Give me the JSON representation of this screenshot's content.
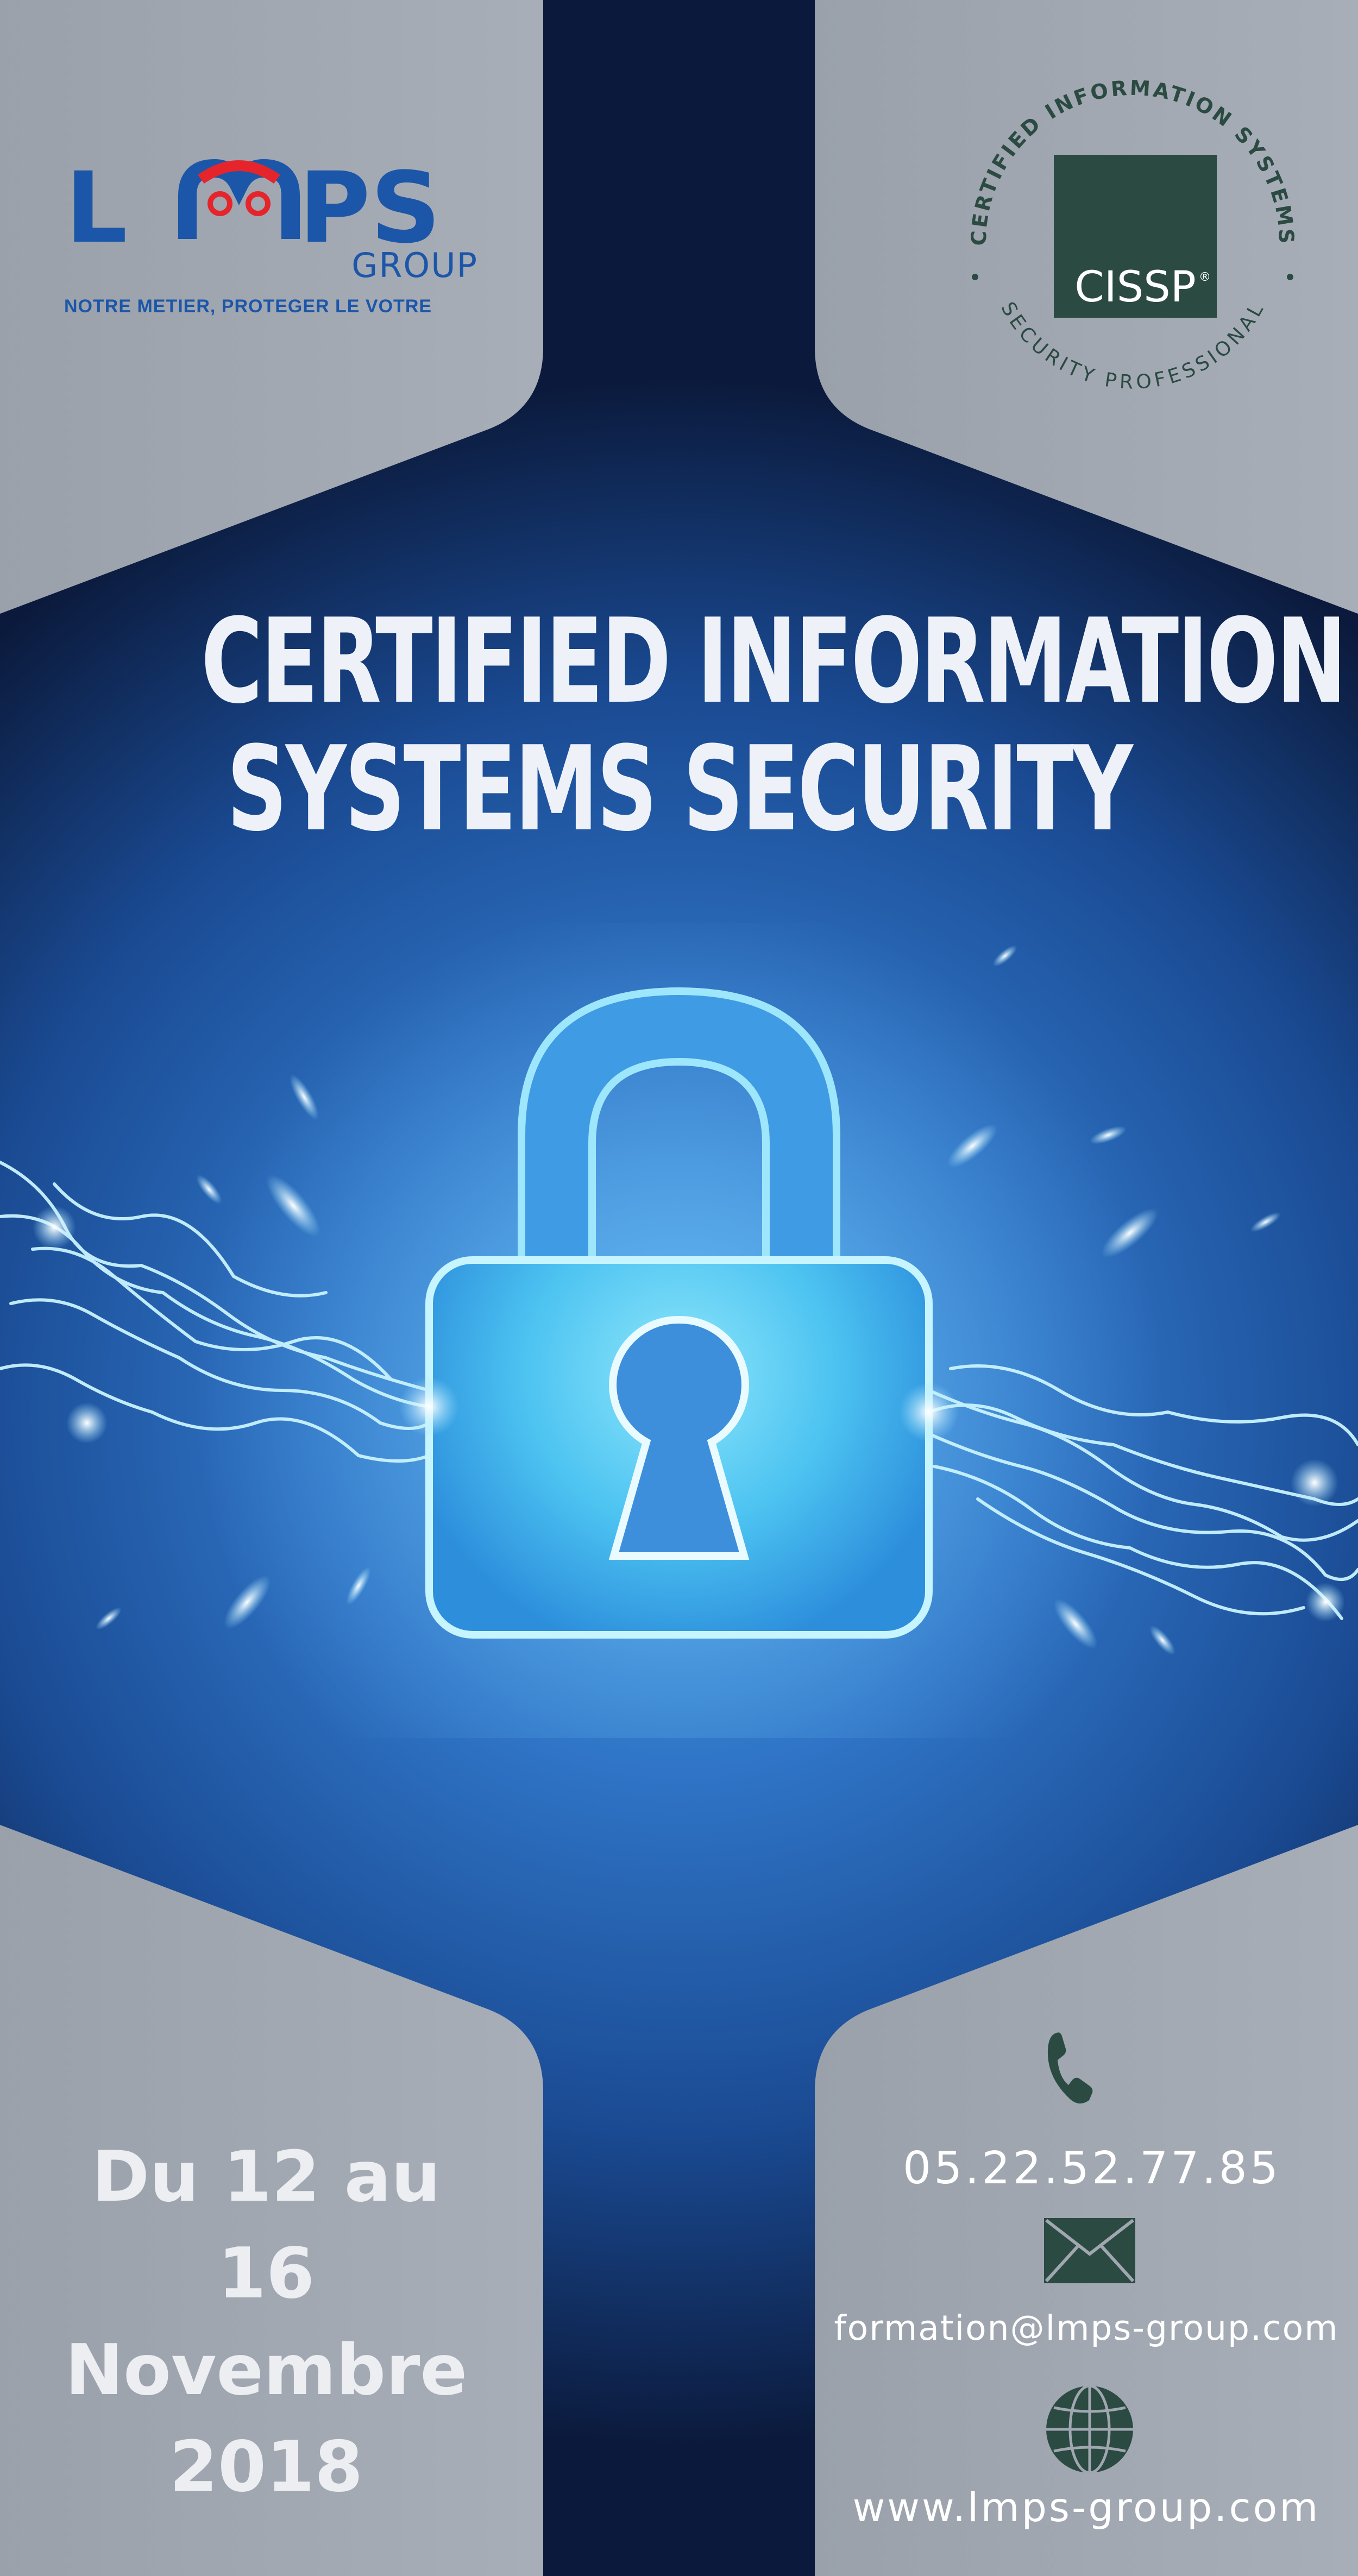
{
  "logo": {
    "letters_left": "L",
    "letters_right": "PS",
    "group": "GROUP",
    "tagline": "NOTRE METIER, PROTEGER LE VOTRE"
  },
  "seal": {
    "top_arc": "CERTIFIED INFORMATION SYSTEMS",
    "bottom_arc": "SECURITY PROFESSIONAL",
    "badge": "CISSP",
    "badge_mark": "®"
  },
  "headline": {
    "line1": "CERTIFIED INFORMATION",
    "line2": "SYSTEMS SECURITY"
  },
  "event_date": {
    "line1": "Du 12 au",
    "line2": "16 Novembre",
    "line3": "2018"
  },
  "contact": {
    "phone": "05.22.52.77.85",
    "email": "formation@lmps-group.com",
    "website": "www.lmps-group.com"
  },
  "icons": {
    "phone": "phone-icon",
    "mail": "mail-icon",
    "globe": "globe-icon",
    "lock": "padlock-icon"
  },
  "colors": {
    "panel_gray": "#a1a7b1",
    "navy_dark": "#0b1a3c",
    "blue_glow": "#3b86d6",
    "brand_blue": "#1c56a8",
    "brand_red": "#e5252b",
    "seal_green": "#2b4a42"
  }
}
